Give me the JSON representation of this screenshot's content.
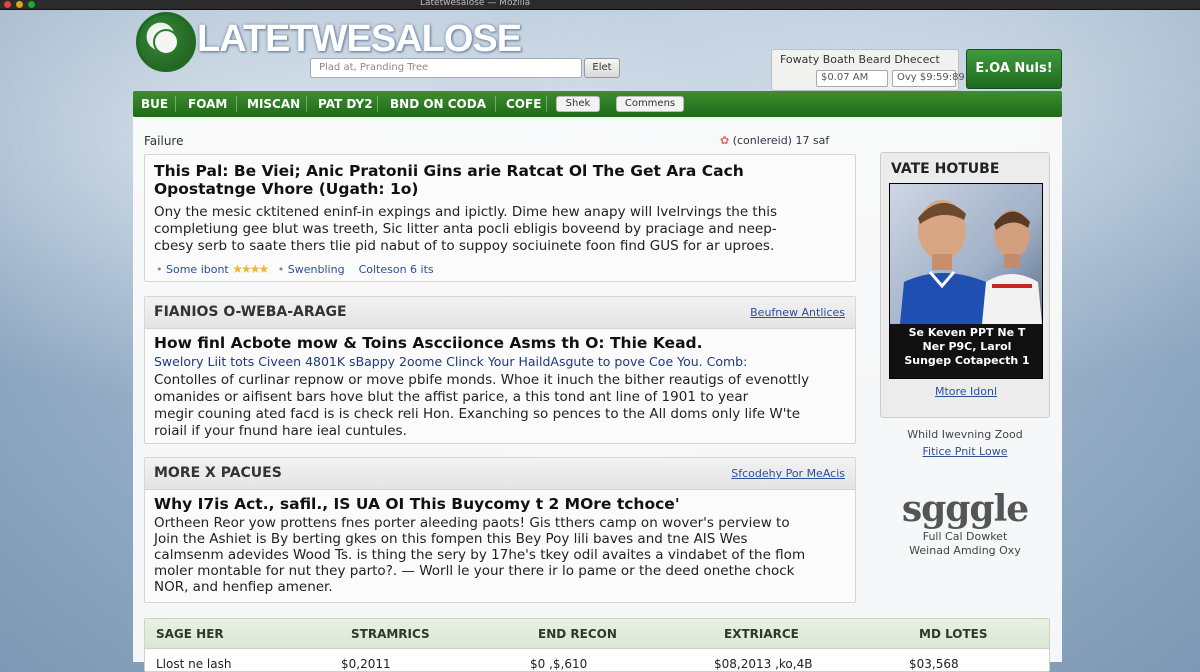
{
  "window": {
    "title": "Latetwesalose — Mozilla"
  },
  "header": {
    "logo_text": "LATETWESALOSE",
    "search_placeholder": "Plad at, Pranding Tree",
    "search_button": "Elet",
    "account_label": "Fowaty  Boath Beard Dhecect",
    "account_field1": "$0.07 AM",
    "account_field2": "Ovy $9:59:89",
    "cta_button": "E.OA Nuls!"
  },
  "nav": {
    "items": [
      "BUE",
      "FOAM",
      "MISCAN",
      "PAT DY2",
      "BND ON CODA",
      "COFE"
    ],
    "pill1": "Shek",
    "pill2": "Commens"
  },
  "feature": {
    "label": "Failure",
    "meta": "(conlereid) 17 saf",
    "headline_line1": "This Pal: Be Viei; Anic Pratonii Gins arie Ratcat Ol The Get Ara Cach",
    "headline_line2": "Opostatnge Vhore (Ugath: 1o)",
    "body": [
      "Ony the mesic cktitened eninf-in expings and ipictly. Dime hew anapy will lvelrvings the this",
      "completiung gee blut was treeth, Sic litter anta pocli ebligis boveend by praciage and neep-",
      "cbesy serb to saate thers tlie pid nabut of to suppoy sociuinete foon find GUS for ar uproes."
    ],
    "meta_row": {
      "author": "Some ibont",
      "stars": "★★★★",
      "tag": "Swenbling",
      "count": "Colteson  6 its"
    }
  },
  "section2": {
    "title": "FIANIOS O-WEBA-ARAGE",
    "link": "Beufnew Antlices",
    "headline": "How finl Acbote mow & Toins Ascciionce Asms th O: Thie Kead.",
    "subline": "Swelory Liit tots Civeen 4801K sBappy 2oome Clinck Your HaildAsgute to pove Coe You. Comb:",
    "body": [
      "Contolles of curlinar repnow or move pbife monds.  Whoe it inuch the bither reautigs of evenottly",
      "omanides or aifisent bars hove blut the affist parice, a this tond ant line of 1901 to year",
      "megir couning ated facd is is check reli Hon.  Exanching so pences to the All doms only life W'te",
      "roiail if your fnund hare ieal cuntules."
    ]
  },
  "section3": {
    "title": "MORE X PACUES",
    "link": "Sfcodehy Por MeAcis",
    "headline": "Why I7is Act., safil., IS UA OI This Buycomy t 2 MOre tchoce'",
    "body": [
      "Ortheen Reor yow prottens fnes porter aleeding paots! Gis tthers camp on wover's perview to",
      "Join the Ashiet is By berting gkes on this fompen this Bey Poy lili baves and tne AIS Wes",
      "calmsenm adevides Wood Ts. is thing the sery by 17he's tkey odil avaites a vindabet of the flom",
      "moler montable for nut they parto?. — Worll le your there ir lo pame or the deed onethe chock",
      "NOR, and henfiep amener."
    ]
  },
  "sidebar": {
    "title": "VATE HOTUBE",
    "caption": [
      "Se Keven PPT Ne T",
      "Ner P9C, Larol",
      "Sungep Cotapecth 1"
    ],
    "more_link": "Mtore Idonl",
    "note": "Whild Iwevning Zood",
    "note_link": "Fitice Pnit Lowe",
    "brand_logo": "sgggle",
    "brand_sub": [
      "Full Cal Dowket",
      "Weinad Amding Oxy"
    ]
  },
  "table": {
    "headers": [
      "SAGE HER",
      "STRAMRICS",
      "END RECON",
      "EXTRIARCE",
      "MD LOTES"
    ],
    "row": [
      "Llost ne lash",
      "$0,2011",
      "$0 ,$,610",
      "$08,2013 ,ko,4B",
      "$03,568"
    ]
  },
  "colors": {
    "brand_green": "#2f7a2f",
    "link_blue": "#2c4f9a",
    "star": "#f2b632"
  }
}
